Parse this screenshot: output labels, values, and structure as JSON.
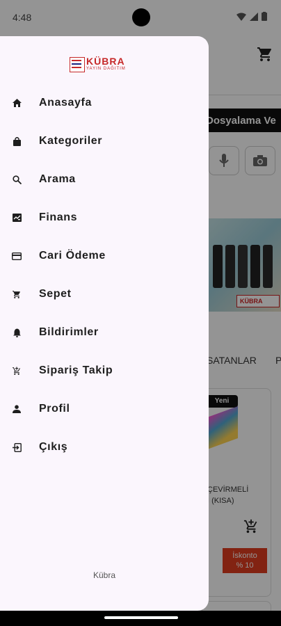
{
  "status_bar": {
    "time": "4:48"
  },
  "background": {
    "banner_text": "Dosyalama Ve",
    "tabs": [
      "SATANLAR",
      "P"
    ],
    "badge": "Yeni",
    "product_name_line1": "ÇEVİRMELİ",
    "product_name_line2": "İ (KISA)",
    "discount_line1": "İskonto",
    "discount_line2": "% 10",
    "promo_logo": "KÜBRA"
  },
  "drawer": {
    "logo": {
      "name": "KÜBRA",
      "subtitle": "YAYIN DAĞITIM"
    },
    "menu": [
      {
        "label": "Anasayfa",
        "icon": "home-icon"
      },
      {
        "label": "Kategoriler",
        "icon": "shopping-bag-icon"
      },
      {
        "label": "Arama",
        "icon": "search-icon"
      },
      {
        "label": "Finans",
        "icon": "finance-icon"
      },
      {
        "label": "Cari Ödeme",
        "icon": "credit-card-icon"
      },
      {
        "label": "Sepet",
        "icon": "cart-icon"
      },
      {
        "label": "Bildirimler",
        "icon": "bell-icon"
      },
      {
        "label": "Sipariş Takip",
        "icon": "order-tracking-icon"
      },
      {
        "label": "Profil",
        "icon": "person-icon"
      },
      {
        "label": "Çıkış",
        "icon": "logout-icon"
      }
    ],
    "footer": "Kübra"
  },
  "colors": {
    "brand": "#c62828",
    "drawer_bg": "#fbf6fd",
    "discount": "#e03d1f"
  }
}
